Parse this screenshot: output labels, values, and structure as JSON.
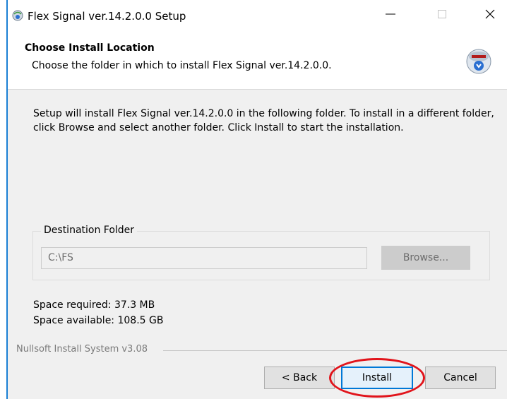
{
  "window": {
    "title": "Flex Signal ver.14.2.0.0 Setup",
    "minimize_glyph": "—",
    "maximize_glyph": "☐",
    "close_glyph": "✕"
  },
  "header": {
    "title": "Choose Install Location",
    "subtitle": "Choose the folder in which to install Flex Signal ver.14.2.0.0.",
    "icon": "nsis-installer-icon"
  },
  "body": {
    "description": "Setup will install Flex Signal ver.14.2.0.0 in the following folder. To install in a different folder, click Browse and select another folder. Click Install to start the installation."
  },
  "destination": {
    "group_label": "Destination Folder",
    "path_value": "C:\\FS",
    "browse_label": "Browse..."
  },
  "space": {
    "required": "Space required: 37.3 MB",
    "available": "Space available: 108.5 GB"
  },
  "footer": {
    "branding": "Nullsoft Install System v3.08",
    "back_label": "< Back",
    "install_label": "Install",
    "cancel_label": "Cancel"
  },
  "colors": {
    "accent": "#0078d7",
    "highlight_circle": "#e1141b",
    "window_border": "#1a7fd4"
  }
}
